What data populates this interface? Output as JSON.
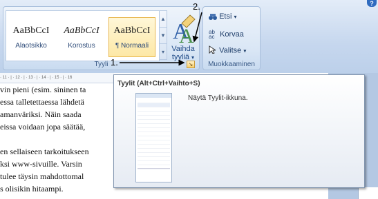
{
  "ribbon": {
    "help_label": "?",
    "styles_group": {
      "label": "Tyyli",
      "styles": [
        {
          "sample": "AaBbCcI",
          "name": "Alaotsikko"
        },
        {
          "sample": "AaBbCcI",
          "name": "Korostus"
        },
        {
          "sample": "AaBbCcI",
          "name": "¶ Normaali"
        }
      ],
      "change_styles_line1": "Vaihda",
      "change_styles_line2": "tyyliä",
      "change_styles_arrow": "▾",
      "launcher_glyph": "↘"
    },
    "editing_group": {
      "label": "Muokkaaminen",
      "find": "Etsi",
      "replace": "Korvaa",
      "select": "Valitse"
    }
  },
  "annotations": {
    "label_1": "1.",
    "label_2": "2."
  },
  "ruler_text": "· 11 · | · 12 · | · 13 · | · 14 · | · 15 · | · 16",
  "document_lines": [
    "vin pieni (esim. sininen ta",
    "essa talletettaessa lähdetä",
    "amanväriksi. Näin saada",
    "eissa voidaan jopa säätää,",
    "",
    "en sellaiseen tarkoitukseen",
    "ksi www-sivuille. Varsin",
    "tulee täysin mahdottomal",
    "s olisikin hitaampi."
  ],
  "tooltip": {
    "title": "Tyylit (Alt+Ctrl+Vaihto+S)",
    "description": "Näytä Tyylit-ikkuna."
  }
}
